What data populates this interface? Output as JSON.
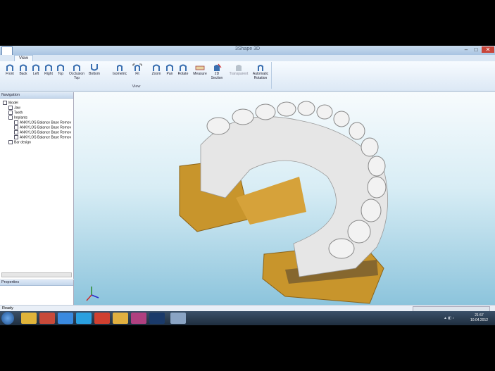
{
  "window": {
    "title": "3Shape 3D"
  },
  "ribbon": {
    "tab": "View",
    "group_label": "View",
    "buttons": [
      {
        "label": "Front"
      },
      {
        "label": "Back"
      },
      {
        "label": "Left"
      },
      {
        "label": "Right"
      },
      {
        "label": "Top"
      },
      {
        "label": "Occlusion Top"
      },
      {
        "label": "Bottom"
      },
      {
        "label": "Isometric"
      },
      {
        "label": "Fit"
      },
      {
        "label": "Zoom"
      },
      {
        "label": "Pan"
      },
      {
        "label": "Rotate"
      },
      {
        "label": "Measure"
      },
      {
        "label": "2D Section"
      },
      {
        "label": "Transparent"
      },
      {
        "label": "Automatic Rotation"
      }
    ]
  },
  "navigation": {
    "title": "Navigation",
    "tree": [
      {
        "label": "Model"
      },
      {
        "label": "Jaw"
      },
      {
        "label": "Teeth"
      },
      {
        "label": "Implants"
      },
      {
        "label": "ANKYLOS Balance Base Remov"
      },
      {
        "label": "ANKYLOS Balance Base Remov"
      },
      {
        "label": "ANKYLOS Balance Base Remov"
      },
      {
        "label": "ANKYLOS Balance Base Remov"
      },
      {
        "label": "Bar design"
      }
    ]
  },
  "properties": {
    "title": "Properties"
  },
  "status": {
    "text": "Ready"
  },
  "taskbar": {
    "time": "21:57",
    "date": "10.04.2012"
  },
  "colors": {
    "titlebar": "#b6cde6",
    "viewport_top": "#f7fbfd",
    "viewport_bottom": "#8cc4dc",
    "model_gold": "#c8952c",
    "model_white": "#e8e8e8"
  }
}
